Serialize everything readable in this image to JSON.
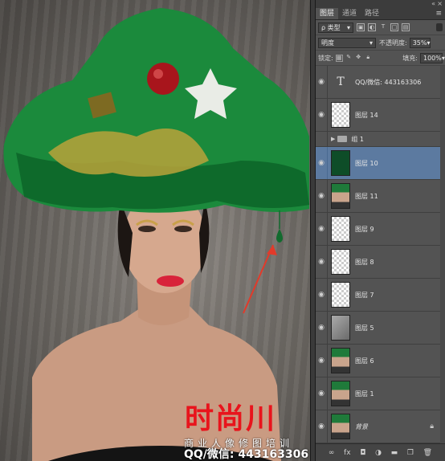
{
  "watermark": {
    "logo": "时尚川",
    "subtitle": "商业人像修图培训",
    "qq": "QQ/微信: 443163306"
  },
  "panel": {
    "collapse_icon": "«",
    "close_icon": "×",
    "menu_icon": "≡",
    "tabs": [
      {
        "label": "图层",
        "active": true
      },
      {
        "label": "通道",
        "active": false
      },
      {
        "label": "路径",
        "active": false
      }
    ],
    "filter": {
      "label": "ρ 类型"
    },
    "filter_icons": [
      "image-filter-icon",
      "adjustment-filter-icon",
      "text-filter-icon",
      "shape-filter-icon",
      "smart-object-filter-icon"
    ],
    "blend_mode": "明度",
    "opacity_label": "不透明度:",
    "opacity_value": "35%",
    "lock_label": "锁定:",
    "fill_label": "填充:",
    "fill_value": "100%",
    "bottom_icons": [
      "link-icon",
      "fx-icon",
      "mask-icon",
      "adjustment-icon",
      "folder-icon",
      "new-layer-icon",
      "trash-icon"
    ]
  },
  "layers": [
    {
      "name": "QQ/微信: 443163306",
      "kind": "text"
    },
    {
      "name": "图层 14",
      "kind": "checker"
    },
    {
      "name": "组 1",
      "kind": "group"
    },
    {
      "name": "图层 10",
      "kind": "green",
      "selected": true
    },
    {
      "name": "图层 11",
      "kind": "photo"
    },
    {
      "name": "图层 9",
      "kind": "checker"
    },
    {
      "name": "图层 8",
      "kind": "checker"
    },
    {
      "name": "图层 7",
      "kind": "checker"
    },
    {
      "name": "图层 5",
      "kind": "gray"
    },
    {
      "name": "图层 6",
      "kind": "photo"
    },
    {
      "name": "图层 1",
      "kind": "photo"
    },
    {
      "name": "背景",
      "kind": "photo",
      "locked": true
    }
  ],
  "colors": {
    "watermark_red": "#e8141c",
    "selection_blue": "#5c7aa0",
    "annotation_arrow": "#e23a2a"
  }
}
